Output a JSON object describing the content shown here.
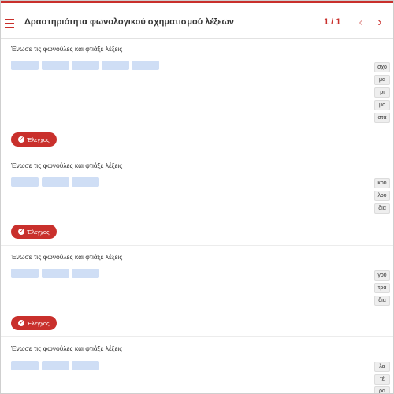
{
  "header": {
    "title": "Δραστηριότητα φωνολογικού σχηματισμού λέξεων",
    "pager": "1 / 1",
    "prev_icon": "‹",
    "next_icon": "›"
  },
  "colors": {
    "accent": "#c9302c",
    "slot": "#cfdef5",
    "tile": "#eeeeee"
  },
  "exercises": [
    {
      "instruction": "Ένωσε τις φωνούλες και φτιάξε λέξεις",
      "syllables": [
        "σχο",
        "μα",
        "ρι",
        "μο",
        "στά"
      ],
      "check_label": "Έλεγχος"
    },
    {
      "instruction": "Ένωσε τις φωνούλες και φτιάξε λέξεις",
      "syllables": [
        "κού",
        "λου",
        "δια"
      ],
      "check_label": "Έλεγχος"
    },
    {
      "instruction": "Ένωσε τις φωνούλες και φτιάξε λέξεις",
      "syllables": [
        "γού",
        "τρα",
        "δια"
      ],
      "check_label": "Έλεγχος"
    },
    {
      "instruction": "Ένωσε τις φωνούλες και φτιάξε λέξεις",
      "syllables": [
        "λα",
        "τέ",
        "ρα"
      ]
    }
  ]
}
